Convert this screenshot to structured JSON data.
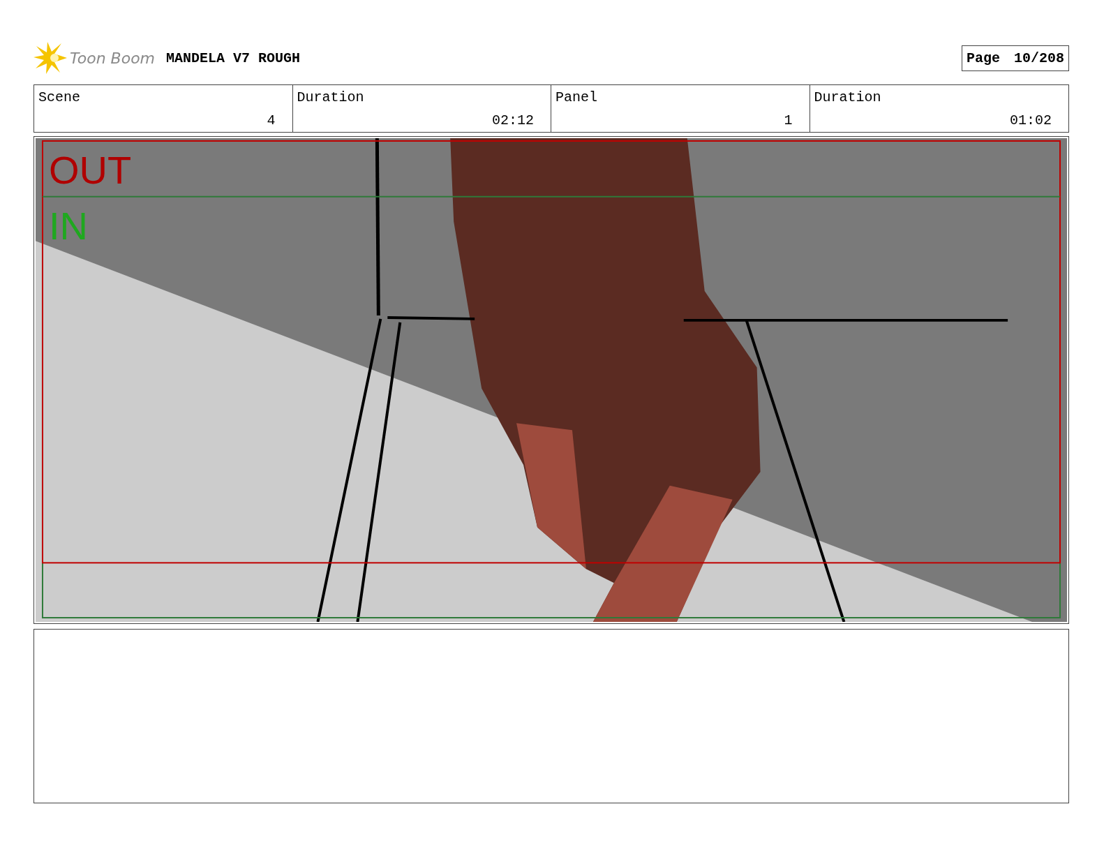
{
  "header": {
    "logo": "Toon Boom",
    "title": "MANDELA V7 ROUGH",
    "page_label": "Page",
    "page_number": "10/208"
  },
  "info": [
    {
      "label": "Scene",
      "value": "4"
    },
    {
      "label": "Duration",
      "value": "02:12"
    },
    {
      "label": "Panel",
      "value": "1"
    },
    {
      "label": "Duration",
      "value": "01:02"
    }
  ],
  "panel": {
    "out_label": "OUT",
    "in_label": "IN"
  }
}
